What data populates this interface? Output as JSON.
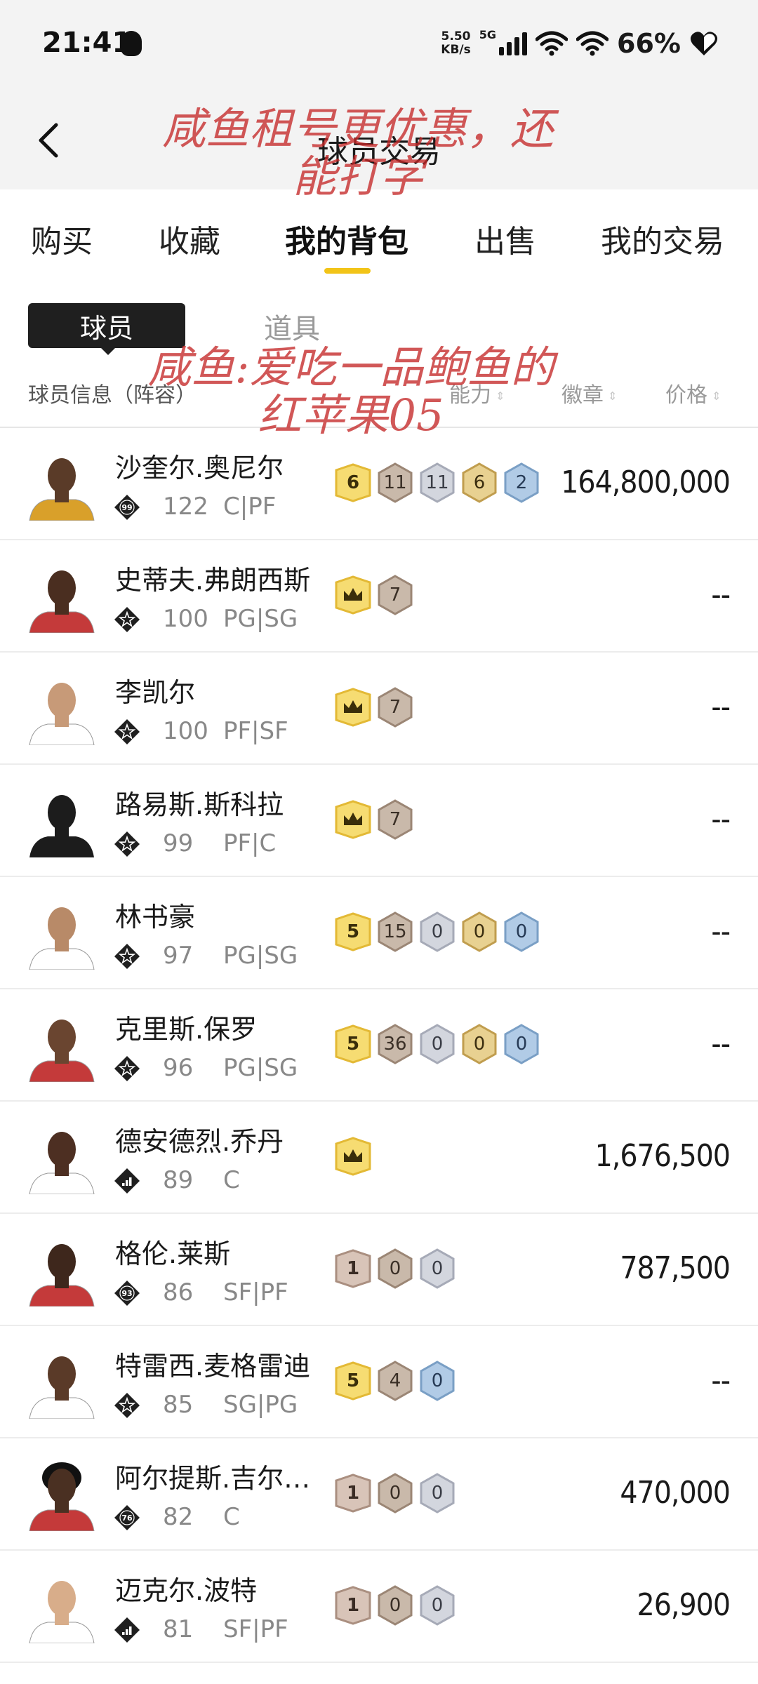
{
  "status_bar": {
    "time": "21:41",
    "net_speed_value": "5.50",
    "net_speed_unit": "KB/s",
    "network": "5G",
    "battery": "66%"
  },
  "nav": {
    "title": "球员交易"
  },
  "tabs": [
    {
      "label": "购买",
      "active": false
    },
    {
      "label": "收藏",
      "active": false
    },
    {
      "label": "我的背包",
      "active": true
    },
    {
      "label": "出售",
      "active": false
    },
    {
      "label": "我的交易",
      "active": false
    }
  ],
  "segments": {
    "active": "球员",
    "inactive": "道具"
  },
  "columns": {
    "info": "球员信息（阵容）",
    "ability": "能力",
    "badges": "徽章",
    "price": "价格"
  },
  "players": [
    {
      "name": "沙奎尔.奥尼尔",
      "ovr": "122",
      "pos": "C|PF",
      "tier": "99",
      "price": "164,800,000",
      "badges": [
        {
          "t": "yellow",
          "v": "6"
        },
        {
          "t": "bronze",
          "v": "11"
        },
        {
          "t": "silver",
          "v": "11"
        },
        {
          "t": "gold",
          "v": "6"
        },
        {
          "t": "blue",
          "v": "2"
        }
      ]
    },
    {
      "name": "史蒂夫.弗朗西斯",
      "ovr": "100",
      "pos": "PG|SG",
      "tier": "star",
      "price": "--",
      "badges": [
        {
          "t": "crown",
          "v": ""
        },
        {
          "t": "bronze",
          "v": "7"
        }
      ]
    },
    {
      "name": "李凯尔",
      "ovr": "100",
      "pos": "PF|SF",
      "tier": "star",
      "price": "--",
      "badges": [
        {
          "t": "crown",
          "v": ""
        },
        {
          "t": "bronze",
          "v": "7"
        }
      ]
    },
    {
      "name": "路易斯.斯科拉",
      "ovr": "99",
      "pos": "PF|C",
      "tier": "star",
      "price": "--",
      "badges": [
        {
          "t": "crown",
          "v": ""
        },
        {
          "t": "bronze",
          "v": "7"
        }
      ]
    },
    {
      "name": "林书豪",
      "ovr": "97",
      "pos": "PG|SG",
      "tier": "star",
      "price": "--",
      "badges": [
        {
          "t": "yellow",
          "v": "5"
        },
        {
          "t": "bronze",
          "v": "15"
        },
        {
          "t": "silver",
          "v": "0"
        },
        {
          "t": "gold",
          "v": "0"
        },
        {
          "t": "blue",
          "v": "0"
        }
      ]
    },
    {
      "name": "克里斯.保罗",
      "ovr": "96",
      "pos": "PG|SG",
      "tier": "star",
      "price": "--",
      "badges": [
        {
          "t": "yellow",
          "v": "5"
        },
        {
          "t": "bronze",
          "v": "36"
        },
        {
          "t": "silver",
          "v": "0"
        },
        {
          "t": "gold",
          "v": "0"
        },
        {
          "t": "blue",
          "v": "0"
        }
      ]
    },
    {
      "name": "德安德烈.乔丹",
      "ovr": "89",
      "pos": "C",
      "tier": "bars",
      "price": "1,676,500",
      "badges": [
        {
          "t": "crown",
          "v": ""
        }
      ]
    },
    {
      "name": "格伦.莱斯",
      "ovr": "86",
      "pos": "SF|PF",
      "tier": "93",
      "price": "787,500",
      "badges": [
        {
          "t": "rose",
          "v": "1"
        },
        {
          "t": "bronze",
          "v": "0"
        },
        {
          "t": "silver",
          "v": "0"
        }
      ]
    },
    {
      "name": "特雷西.麦格雷迪",
      "ovr": "85",
      "pos": "SG|PG",
      "tier": "star",
      "price": "--",
      "badges": [
        {
          "t": "yellow",
          "v": "5"
        },
        {
          "t": "bronze",
          "v": "4"
        },
        {
          "t": "blue",
          "v": "0"
        }
      ]
    },
    {
      "name": "阿尔提斯.吉尔…",
      "ovr": "82",
      "pos": "C",
      "tier": "76",
      "price": "470,000",
      "badges": [
        {
          "t": "rose",
          "v": "1"
        },
        {
          "t": "bronze",
          "v": "0"
        },
        {
          "t": "silver",
          "v": "0"
        }
      ]
    },
    {
      "name": "迈克尔.波特",
      "ovr": "81",
      "pos": "SF|PF",
      "tier": "bars",
      "price": "26,900",
      "badges": [
        {
          "t": "rose",
          "v": "1"
        },
        {
          "t": "bronze",
          "v": "0"
        },
        {
          "t": "silver",
          "v": "0"
        }
      ]
    }
  ],
  "watermarks": {
    "top": "咸鱼租号更优惠，还\n能打字",
    "middle": "咸鱼:爱吃一品鲍鱼的\n红苹果05"
  },
  "colors": {
    "accent": "#f2c418",
    "watermark": "#c42828",
    "yellow_badge": "#f3d25a",
    "bronze_badge": "#b9a99a",
    "silver_badge": "#c3c6d0",
    "gold_badge": "#d9bf7c",
    "blue_badge": "#9ab9d8",
    "rose_badge": "#c8b2a6"
  }
}
